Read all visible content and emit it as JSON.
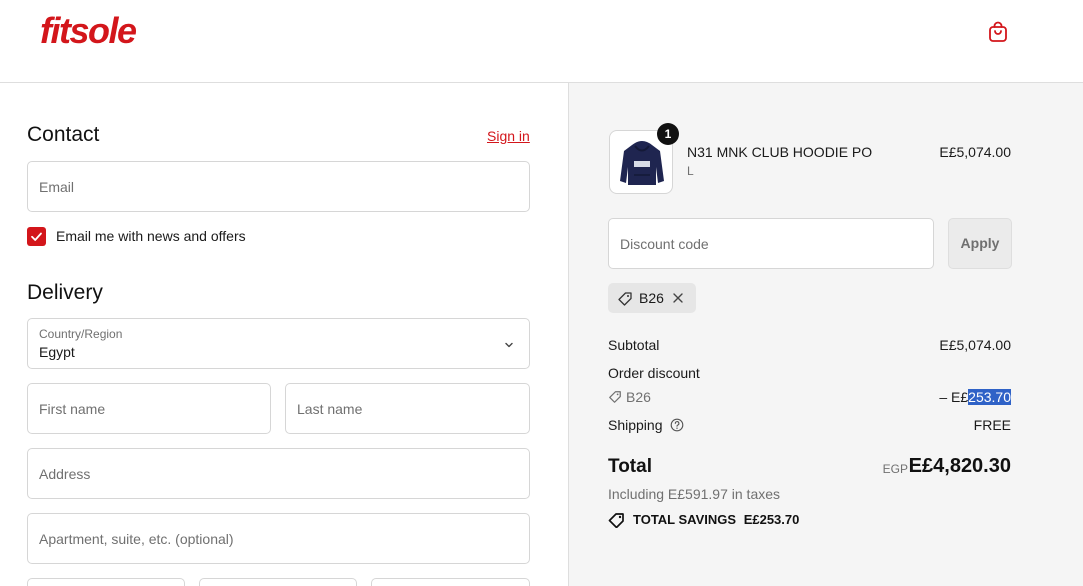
{
  "brand": {
    "logo_text": "fitsole",
    "accent": "#d3161b"
  },
  "header": {
    "cart_icon": "shopping-bag-icon"
  },
  "contact": {
    "title": "Contact",
    "signin_label": "Sign in",
    "email_placeholder": "Email",
    "newsletter_label": "Email me with news and offers",
    "newsletter_checked": true
  },
  "delivery": {
    "title": "Delivery",
    "country_label": "Country/Region",
    "country_value": "Egypt",
    "first_name_placeholder": "First name",
    "last_name_placeholder": "Last name",
    "address_placeholder": "Address",
    "apartment_placeholder": "Apartment, suite, etc. (optional)"
  },
  "order": {
    "item": {
      "name": "N31 MNK CLUB HOODIE PO",
      "variant": "L",
      "price": "E£5,074.00",
      "quantity": "1"
    },
    "discount_placeholder": "Discount code",
    "apply_label": "Apply",
    "applied_code": "B26",
    "subtotal_label": "Subtotal",
    "subtotal_value": "E£5,074.00",
    "order_discount_label": "Order discount",
    "discount_code": "B26",
    "discount_prefix": "– E£",
    "discount_amount": "253.70",
    "shipping_label": "Shipping",
    "shipping_value": "FREE",
    "total_label": "Total",
    "total_currency": "EGP",
    "total_value": "E£4,820.30",
    "taxes_text": "Including E£591.97 in taxes",
    "savings_label": "TOTAL SAVINGS",
    "savings_value": "E£253.70"
  }
}
